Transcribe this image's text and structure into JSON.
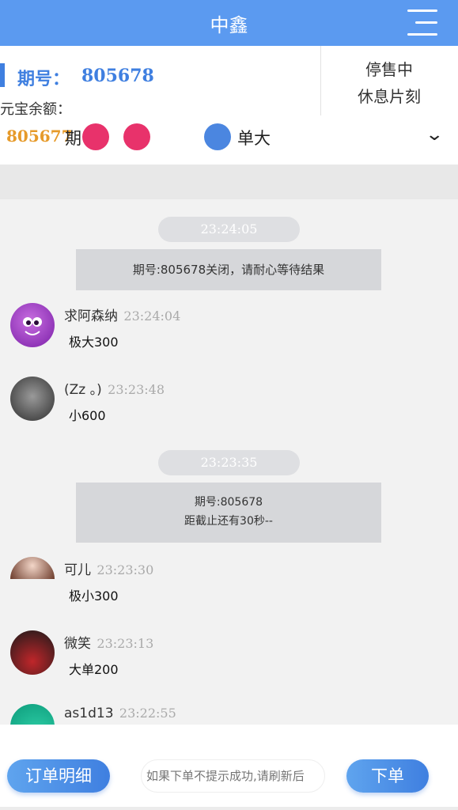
{
  "header": {
    "title": "中鑫"
  },
  "info": {
    "period_label": "期号：",
    "period_value": "805678",
    "balance_label": "元宝余额：",
    "status_1": "停售中",
    "status_2": "休息片刻"
  },
  "last_result": {
    "period": "805677",
    "label": "期",
    "ball_1": "",
    "ball_2": "",
    "ball_3": "",
    "result": "单大"
  },
  "chat": {
    "time_1": "23:24:05",
    "sys_1": "期号:805678关闭，请耐心等待结果",
    "messages": [
      {
        "name": "求阿森纳",
        "time": "23:24:04",
        "text": "极大300"
      },
      {
        "name": "(Zz 。)",
        "time": "23:23:48",
        "text": "小600"
      },
      {
        "name": "可儿",
        "time": "23:23:30",
        "text": "极小300"
      },
      {
        "name": "微笑",
        "time": "23:23:13",
        "text": "大单200"
      },
      {
        "name": "as1d13",
        "time": "23:22:55",
        "text": ""
      }
    ],
    "time_2": "23:23:35",
    "sys_2_line1": "期号:805678",
    "sys_2_line2": "距截止还有30秒--"
  },
  "bottom": {
    "orders_label": "订单明细",
    "input_placeholder": "如果下单不提示成功,请刷新后",
    "order_label": "下单"
  },
  "colors": {
    "brand": "#5b9af0",
    "accent": "#3f7fe0",
    "last_period": "#e69a2a",
    "ball_red": "#e8326b",
    "ball_blue": "#4b86e0"
  }
}
